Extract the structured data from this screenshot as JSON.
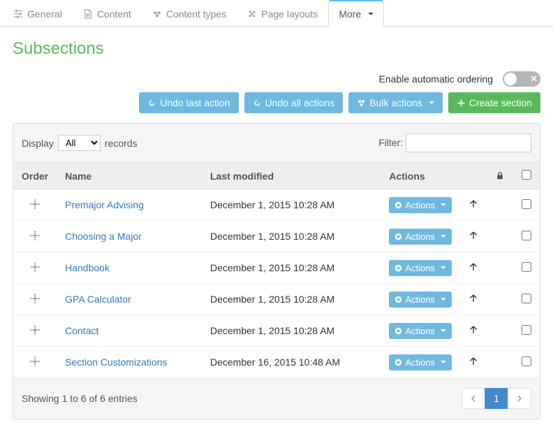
{
  "tabs": [
    {
      "label": "General"
    },
    {
      "label": "Content"
    },
    {
      "label": "Content types"
    },
    {
      "label": "Page layouts"
    },
    {
      "label": "More"
    }
  ],
  "pageTitle": "Subsections",
  "toggle": {
    "label": "Enable automatic ordering"
  },
  "buttons": {
    "undoLast": "Undo last action",
    "undoAll": "Undo all actions",
    "bulk": "Bulk actions",
    "create": "Create section"
  },
  "displayControls": {
    "displayLabel": "Display",
    "selectValue": "All",
    "recordsLabel": "records",
    "filterLabel": "Filter:"
  },
  "columns": {
    "order": "Order",
    "name": "Name",
    "lastModified": "Last modified",
    "actions": "Actions"
  },
  "rows": [
    {
      "name": "Premajor Advising",
      "modified": "December 1, 2015 10:28 AM"
    },
    {
      "name": "Choosing a Major",
      "modified": "December 1, 2015 10:28 AM"
    },
    {
      "name": "Handbook",
      "modified": "December 1, 2015 10:28 AM"
    },
    {
      "name": "GPA Calculator",
      "modified": "December 1, 2015 10:28 AM"
    },
    {
      "name": "Contact",
      "modified": "December 1, 2015 10:28 AM"
    },
    {
      "name": "Section Customizations",
      "modified": "December 16, 2015 10:48 AM"
    }
  ],
  "actionLabel": "Actions",
  "footer": {
    "summary": "Showing 1 to 6 of 6 entries",
    "page": "1"
  }
}
